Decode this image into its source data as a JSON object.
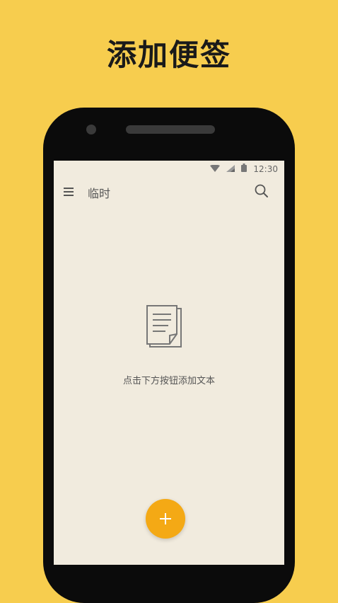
{
  "promo": {
    "headline": "添加便签"
  },
  "status_bar": {
    "time": "12:30"
  },
  "app_bar": {
    "title": "临时"
  },
  "empty_state": {
    "message": "点击下方按钮添加文本"
  },
  "fab": {
    "label": "+"
  },
  "colors": {
    "background": "#F7CD4E",
    "screen": "#F1EBDE",
    "fab": "#F4A915"
  },
  "icons": [
    "wifi-icon",
    "signal-icon",
    "battery-icon",
    "menu-icon",
    "search-icon",
    "document-icon",
    "plus-icon"
  ]
}
